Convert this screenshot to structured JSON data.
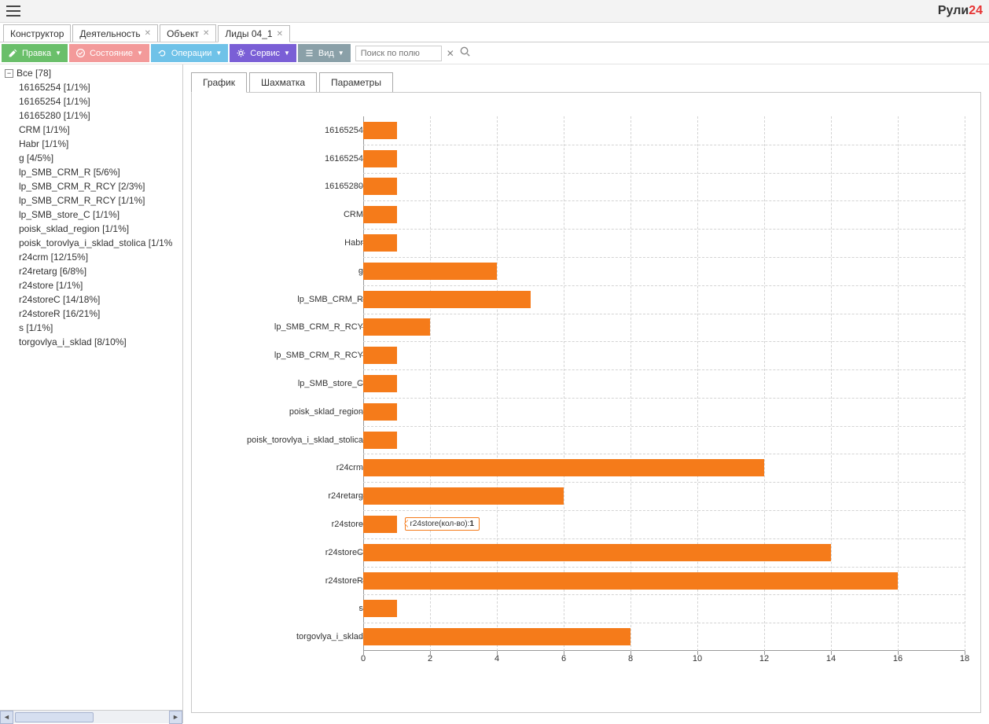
{
  "brand": {
    "p1": "Рули",
    "p2": "24"
  },
  "tabs": [
    {
      "label": "Конструктор",
      "closable": false
    },
    {
      "label": "Деятельность",
      "closable": true
    },
    {
      "label": "Объект",
      "closable": true
    },
    {
      "label": "Лиды 04_1",
      "closable": true,
      "active": true
    }
  ],
  "toolbar": {
    "edit": "Правка",
    "state": "Состояние",
    "operations": "Операции",
    "service": "Сервис",
    "view": "Вид",
    "search_placeholder": "Поиск по полю"
  },
  "tree": {
    "root": "Все [78]",
    "items": [
      "16165254 [1/1%]",
      "16165254 [1/1%]",
      "16165280 [1/1%]",
      "CRM [1/1%]",
      "Habr [1/1%]",
      "g [4/5%]",
      "lp_SMB_CRM_R [5/6%]",
      "lp_SMB_CRM_R_RCY [2/3%]",
      "lp_SMB_CRM_R_RCY [1/1%]",
      "lp_SMB_store_C [1/1%]",
      "poisk_sklad_region [1/1%]",
      "poisk_torovlya_i_sklad_stolica [1/1%",
      "r24crm [12/15%]",
      "r24retarg [6/8%]",
      "r24store [1/1%]",
      "r24storeC [14/18%]",
      "r24storeR [16/21%]",
      "s [1/1%]",
      "torgovlya_i_sklad [8/10%]"
    ]
  },
  "subtabs": {
    "chart": "График",
    "chess": "Шахматка",
    "params": "Параметры"
  },
  "tooltip": {
    "text": "r24store(кол-во): ",
    "value": "1"
  },
  "chart_data": {
    "type": "bar",
    "orientation": "horizontal",
    "categories": [
      "16165254",
      "16165254",
      "16165280",
      "CRM",
      "Habr",
      "g",
      "lp_SMB_CRM_R",
      "lp_SMB_CRM_R_RCY",
      "lp_SMB_CRM_R_RCY",
      "lp_SMB_store_C",
      "poisk_sklad_region",
      "poisk_torovlya_i_sklad_stolica",
      "r24crm",
      "r24retarg",
      "r24store",
      "r24storeC",
      "r24storeR",
      "s",
      "torgovlya_i_sklad"
    ],
    "values": [
      1,
      1,
      1,
      1,
      1,
      4,
      5,
      2,
      1,
      1,
      1,
      1,
      12,
      6,
      1,
      14,
      16,
      1,
      8
    ],
    "xlim": [
      0,
      18
    ],
    "x_ticks": [
      0,
      2,
      4,
      6,
      8,
      10,
      12,
      14,
      16,
      18
    ],
    "bar_color": "#f57b1a",
    "title": "",
    "xlabel": "",
    "ylabel": ""
  }
}
